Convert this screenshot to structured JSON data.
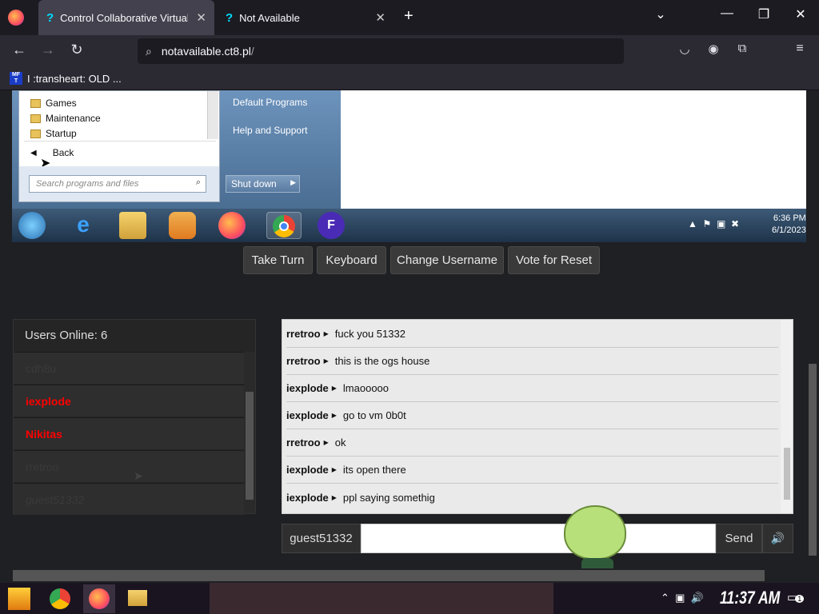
{
  "browser": {
    "tabs": [
      {
        "label": "Control Collaborative Virtual",
        "active": true
      },
      {
        "label": "Not Available",
        "active": false
      }
    ],
    "url_host": "notavailable.ct8.pl",
    "url_path": "/",
    "bookmark": {
      "favicon_text": "MF T",
      "label": "I :transheart: OLD ..."
    }
  },
  "vm": {
    "start_menu_items": [
      "Games",
      "Maintenance",
      "Startup"
    ],
    "back_label": "Back",
    "search_placeholder": "Search programs and files",
    "right_items": [
      "Default Programs",
      "Help and Support"
    ],
    "shutdown_label": "Shut down",
    "clock_time": "6:36 PM",
    "clock_date": "6/1/2023"
  },
  "controls": {
    "take_turn": "Take Turn",
    "keyboard": "Keyboard",
    "change_username": "Change Username",
    "vote_reset": "Vote for Reset"
  },
  "users": {
    "title": "Users Online: 6",
    "list": [
      {
        "name": "cdh8u",
        "style": "normal"
      },
      {
        "name": "iexplode",
        "style": "admin"
      },
      {
        "name": "Nikitas",
        "style": "admin"
      },
      {
        "name": "rretroo",
        "style": "normal"
      },
      {
        "name": "guest51332",
        "style": "italic"
      }
    ]
  },
  "chat": {
    "messages": [
      {
        "user": "rretroo",
        "text": "fuck you 51332"
      },
      {
        "user": "rretroo",
        "text": "this is the ogs house"
      },
      {
        "user": "iexplode",
        "text": "lmaooooo"
      },
      {
        "user": "iexplode",
        "text": "go to vm 0b0t"
      },
      {
        "user": "rretroo",
        "text": "ok"
      },
      {
        "user": "iexplode",
        "text": "its open there"
      },
      {
        "user": "iexplode",
        "text": "ppl saying somethig"
      }
    ],
    "username": "guest51332",
    "send_label": "Send",
    "input_value": ""
  },
  "os_taskbar": {
    "time": "11:37 AM",
    "notification_count": "1"
  },
  "colors": {
    "admin_red": "#ff0000",
    "accent": "#00ddff"
  }
}
